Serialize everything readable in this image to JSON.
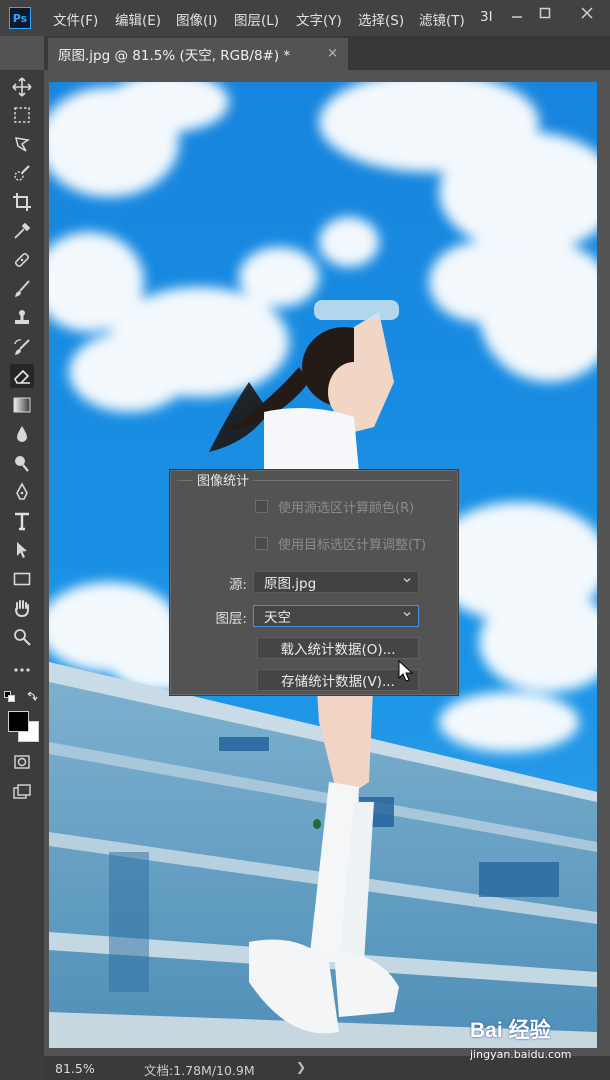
{
  "menubar": {
    "logo": "Ps",
    "items": [
      "文件(F)",
      "编辑(E)",
      "图像(I)",
      "图层(L)",
      "文字(Y)",
      "选择(S)",
      "滤镜(T)",
      "3I"
    ]
  },
  "document_tab": {
    "title": "原图.jpg @ 81.5% (天空, RGB/8#) *",
    "close": "×"
  },
  "dialog": {
    "title": "图像统计",
    "checkbox_source": "使用源选区计算颜色(R)",
    "checkbox_target": "使用目标选区计算调整(T)",
    "source_label": "源:",
    "source_value": "原图.jpg",
    "layer_label": "图层:",
    "layer_value": "天空",
    "load_button": "载入统计数据(O)...",
    "save_button": "存储统计数据(V)..."
  },
  "statusbar": {
    "zoom": "81.5%",
    "doc_info": "文档:1.78M/10.9M",
    "arrow": "❯"
  },
  "watermark": {
    "logo": "Bai 经验",
    "url": "jingyan.baidu.com"
  },
  "colors": {
    "sky": "#1a8fe3",
    "focus": "#4c8fe6",
    "ps_blue": "#31a8ff"
  },
  "tools": [
    "move-tool",
    "marquee-tool",
    "lasso-tool",
    "quick-selection-tool",
    "crop-tool",
    "eyedropper-tool",
    "healing-brush-tool",
    "brush-tool",
    "clone-stamp-tool",
    "history-brush-tool",
    "eraser-tool",
    "gradient-tool",
    "blur-tool",
    "dodge-tool",
    "pen-tool",
    "type-tool",
    "path-selection-tool",
    "rectangle-tool",
    "hand-tool",
    "zoom-tool",
    "more-tools"
  ]
}
